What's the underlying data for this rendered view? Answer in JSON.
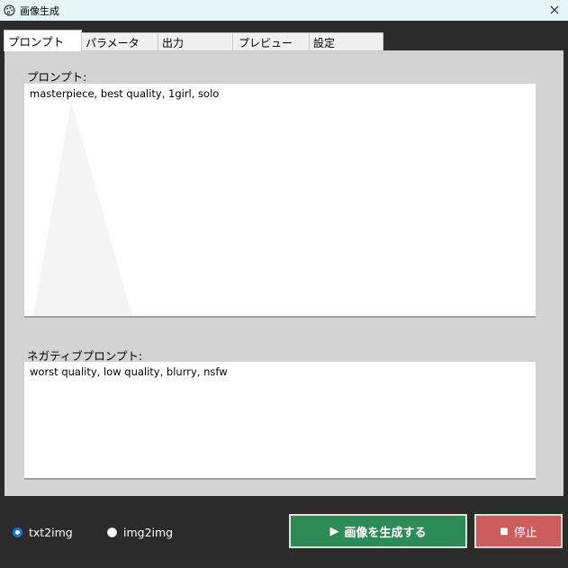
{
  "window": {
    "title": "画像生成",
    "close_glyph": "✕"
  },
  "tabs": [
    {
      "label": "プロンプト",
      "active": true
    },
    {
      "label": "パラメータ",
      "active": false
    },
    {
      "label": "出力",
      "active": false
    },
    {
      "label": "プレビュー",
      "active": false
    },
    {
      "label": "設定",
      "active": false
    }
  ],
  "prompt": {
    "label": "プロンプト:",
    "value": "masterpiece, best quality, 1girl, solo"
  },
  "negative_prompt": {
    "label": "ネガティブプロンプト:",
    "value": "worst quality, low quality, blurry, nsfw"
  },
  "mode": {
    "options": [
      {
        "label": "txt2img",
        "selected": true
      },
      {
        "label": "img2img",
        "selected": false
      }
    ]
  },
  "actions": {
    "generate_glyph": "▶",
    "generate_label": "画像を生成する",
    "stop_glyph": "■",
    "stop_label": "停止"
  },
  "colors": {
    "generate_bg": "#2e8b57",
    "stop_bg": "#cd5c5c",
    "radio_accent": "#1f6fd0"
  }
}
